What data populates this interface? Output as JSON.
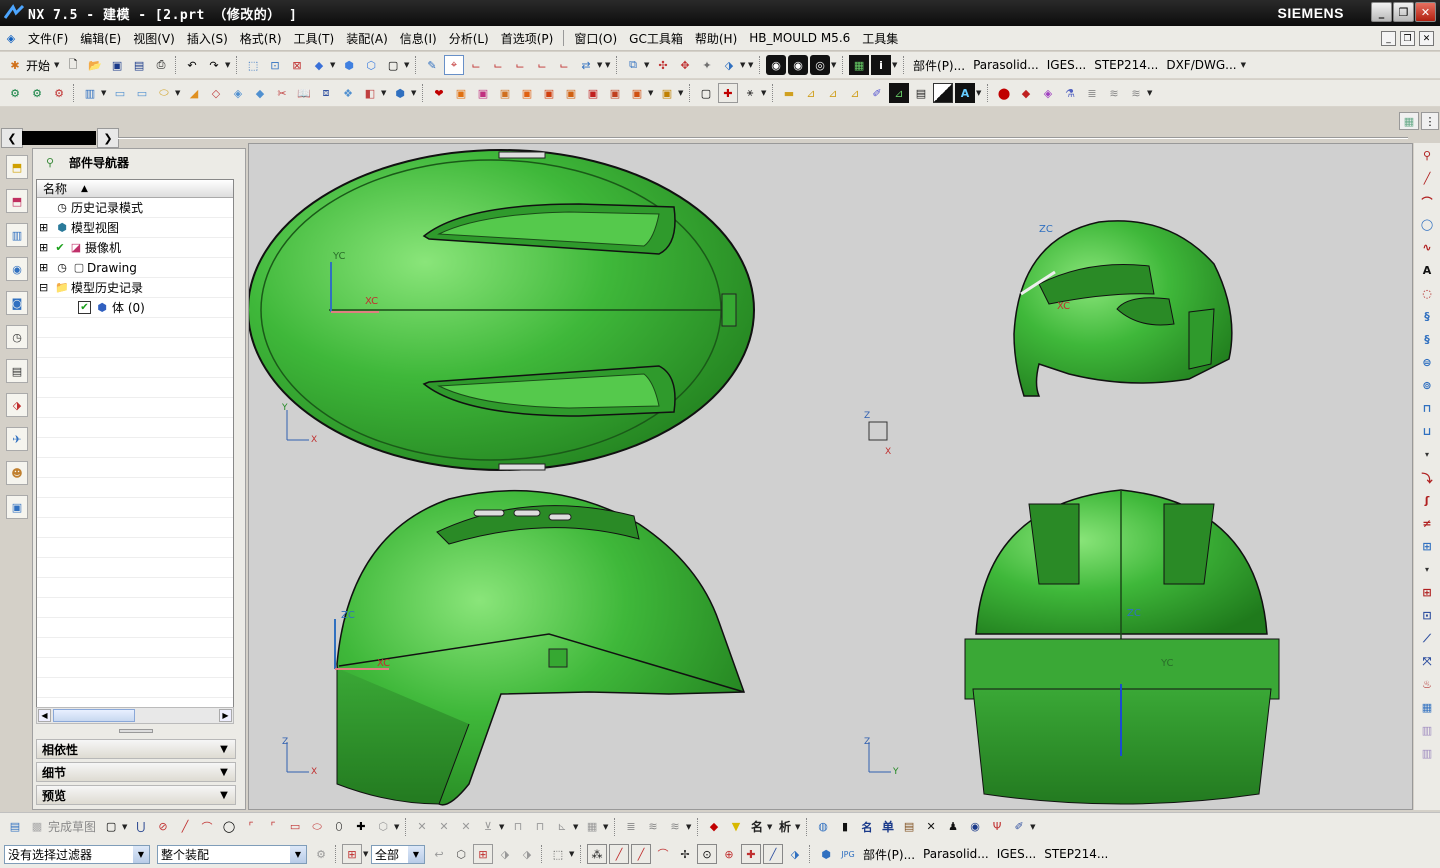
{
  "window": {
    "title": "NX 7.5 - 建模 - [2.prt （修改的） ]",
    "brand": "SIEMENS",
    "controls": [
      "_",
      "❐",
      "✕"
    ]
  },
  "menu": {
    "items": [
      "文件(F)",
      "编辑(E)",
      "视图(V)",
      "插入(S)",
      "格式(R)",
      "工具(T)",
      "装配(A)",
      "信息(I)",
      "分析(L)",
      "首选项(P)",
      "窗口(O)",
      "GC工具箱",
      "帮助(H)",
      "HB_MOULD M5.6",
      "工具集"
    ]
  },
  "toolbar1": {
    "start": "开始",
    "export": [
      "部件(P)...",
      "Parasolid...",
      "IGES...",
      "STEP214...",
      "DXF/DWG..."
    ]
  },
  "navigator": {
    "title": "部件导航器",
    "column_header": "名称",
    "items": [
      {
        "label": "历史记录模式",
        "expand": ""
      },
      {
        "label": "模型视图",
        "expand": "⊞"
      },
      {
        "label": "摄像机",
        "expand": "⊞"
      },
      {
        "label": "Drawing",
        "expand": "⊞"
      },
      {
        "label": "模型历史记录",
        "expand": "⊟"
      },
      {
        "label": "体 (0)",
        "expand": ""
      }
    ],
    "panels": [
      "相依性",
      "细节",
      "预览"
    ]
  },
  "viewport": {
    "background": "#d0d0d0",
    "model_color": "#3fb83a",
    "axis_labels": {
      "xc": "XC",
      "yc": "YC",
      "zc": "ZC",
      "x": "X",
      "y": "Y",
      "z": "Z"
    }
  },
  "bottom_toolbar": {
    "finish_sketch": "完成草图",
    "labels": {
      "name": "名",
      "analyze": "析",
      "single": "单"
    }
  },
  "statusbar": {
    "filter": "没有选择过滤器",
    "assembly": "整个装配",
    "scope": "全部",
    "export": [
      "部件(P)...",
      "Parasolid...",
      "IGES...",
      "STEP214..."
    ]
  }
}
